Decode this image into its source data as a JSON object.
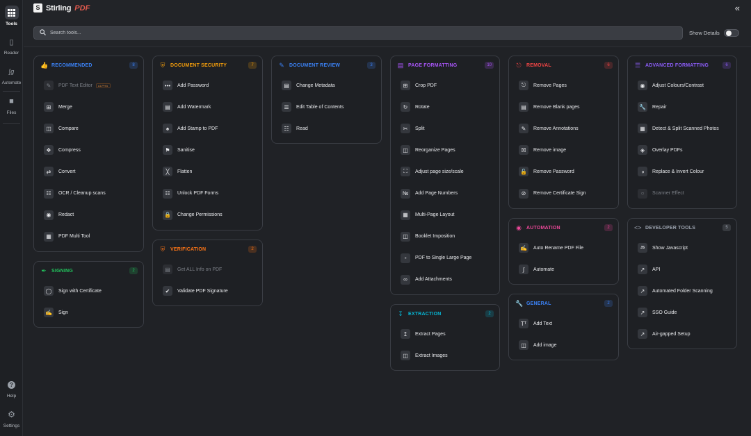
{
  "app": {
    "brand": "Stirling",
    "brand_suffix": "PDF"
  },
  "rail": [
    {
      "label": "Tools",
      "icon": "grid-icon",
      "active": true
    },
    {
      "label": "Reader",
      "icon": "book-icon"
    },
    {
      "label": "Automate",
      "icon": "automate-icon"
    },
    {
      "label": "Files",
      "icon": "folder-icon"
    },
    {
      "label": "Help",
      "icon": "help-icon"
    },
    {
      "label": "Settings",
      "icon": "gear-icon"
    }
  ],
  "search": {
    "placeholder": "Search tools..."
  },
  "details": {
    "label": "Show Details",
    "enabled": false
  },
  "colors": {
    "recommended": "#3b82f6",
    "signing": "#22c55e",
    "security": "#f59e0b",
    "verification": "#f97316",
    "review": "#3b82f6",
    "formatting": "#a855f7",
    "extraction": "#06b6d4",
    "removal": "#ef4444",
    "automation": "#ec4899",
    "general": "#3b82f6",
    "advanced": "#8b5cf6",
    "developer": "#9ca3af"
  },
  "categories": {
    "recommended": {
      "title": "RECOMMENDED",
      "count": "8",
      "tools": [
        "PDF Text Editor",
        "Merge",
        "Compare",
        "Compress",
        "Convert",
        "OCR / Cleanup scans",
        "Redact",
        "PDF Multi Tool"
      ],
      "alpha": "ALPHA"
    },
    "signing": {
      "title": "SIGNING",
      "count": "2",
      "tools": [
        "Sign with Certificate",
        "Sign"
      ]
    },
    "security": {
      "title": "DOCUMENT SECURITY",
      "count": "7",
      "tools": [
        "Add Password",
        "Add Watermark",
        "Add Stamp to PDF",
        "Sanitise",
        "Flatten",
        "Unlock PDF Forms",
        "Change Permissions"
      ]
    },
    "verification": {
      "title": "VERIFICATION",
      "count": "2",
      "tools": [
        "Get ALL Info on PDF",
        "Validate PDF Signature"
      ]
    },
    "review": {
      "title": "DOCUMENT REVIEW",
      "count": "3",
      "tools": [
        "Change Metadata",
        "Edit Table of Contents",
        "Read"
      ]
    },
    "formatting": {
      "title": "PAGE FORMATTING",
      "count": "10",
      "tools": [
        "Crop PDF",
        "Rotate",
        "Split",
        "Reorganize Pages",
        "Adjust page size/scale",
        "Add Page Numbers",
        "Multi-Page Layout",
        "Booklet Imposition",
        "PDF to Single Large Page",
        "Add Attachments"
      ]
    },
    "extraction": {
      "title": "EXTRACTION",
      "count": "2",
      "tools": [
        "Extract Pages",
        "Extract Images"
      ]
    },
    "removal": {
      "title": "REMOVAL",
      "count": "6",
      "tools": [
        "Remove Pages",
        "Remove Blank pages",
        "Remove Annotations",
        "Remove image",
        "Remove Password",
        "Remove Certificate Sign"
      ]
    },
    "automation": {
      "title": "AUTOMATION",
      "count": "2",
      "tools": [
        "Auto Rename PDF File",
        "Automate"
      ]
    },
    "general": {
      "title": "GENERAL",
      "count": "2",
      "tools": [
        "Add Text",
        "Add image"
      ]
    },
    "advanced": {
      "title": "ADVANCED FORMATTING",
      "count": "6",
      "tools": [
        "Adjust Colours/Contrast",
        "Repair",
        "Detect & Split Scanned Photos",
        "Overlay PDFs",
        "Replace & Invert Colour",
        "Scanner Effect"
      ]
    },
    "developer": {
      "title": "DEVELOPER TOOLS",
      "count": "5",
      "tools": [
        "Show Javascript",
        "API",
        "Automated Folder Scanning",
        "SSO Guide",
        "Air-gapped Setup"
      ]
    }
  }
}
